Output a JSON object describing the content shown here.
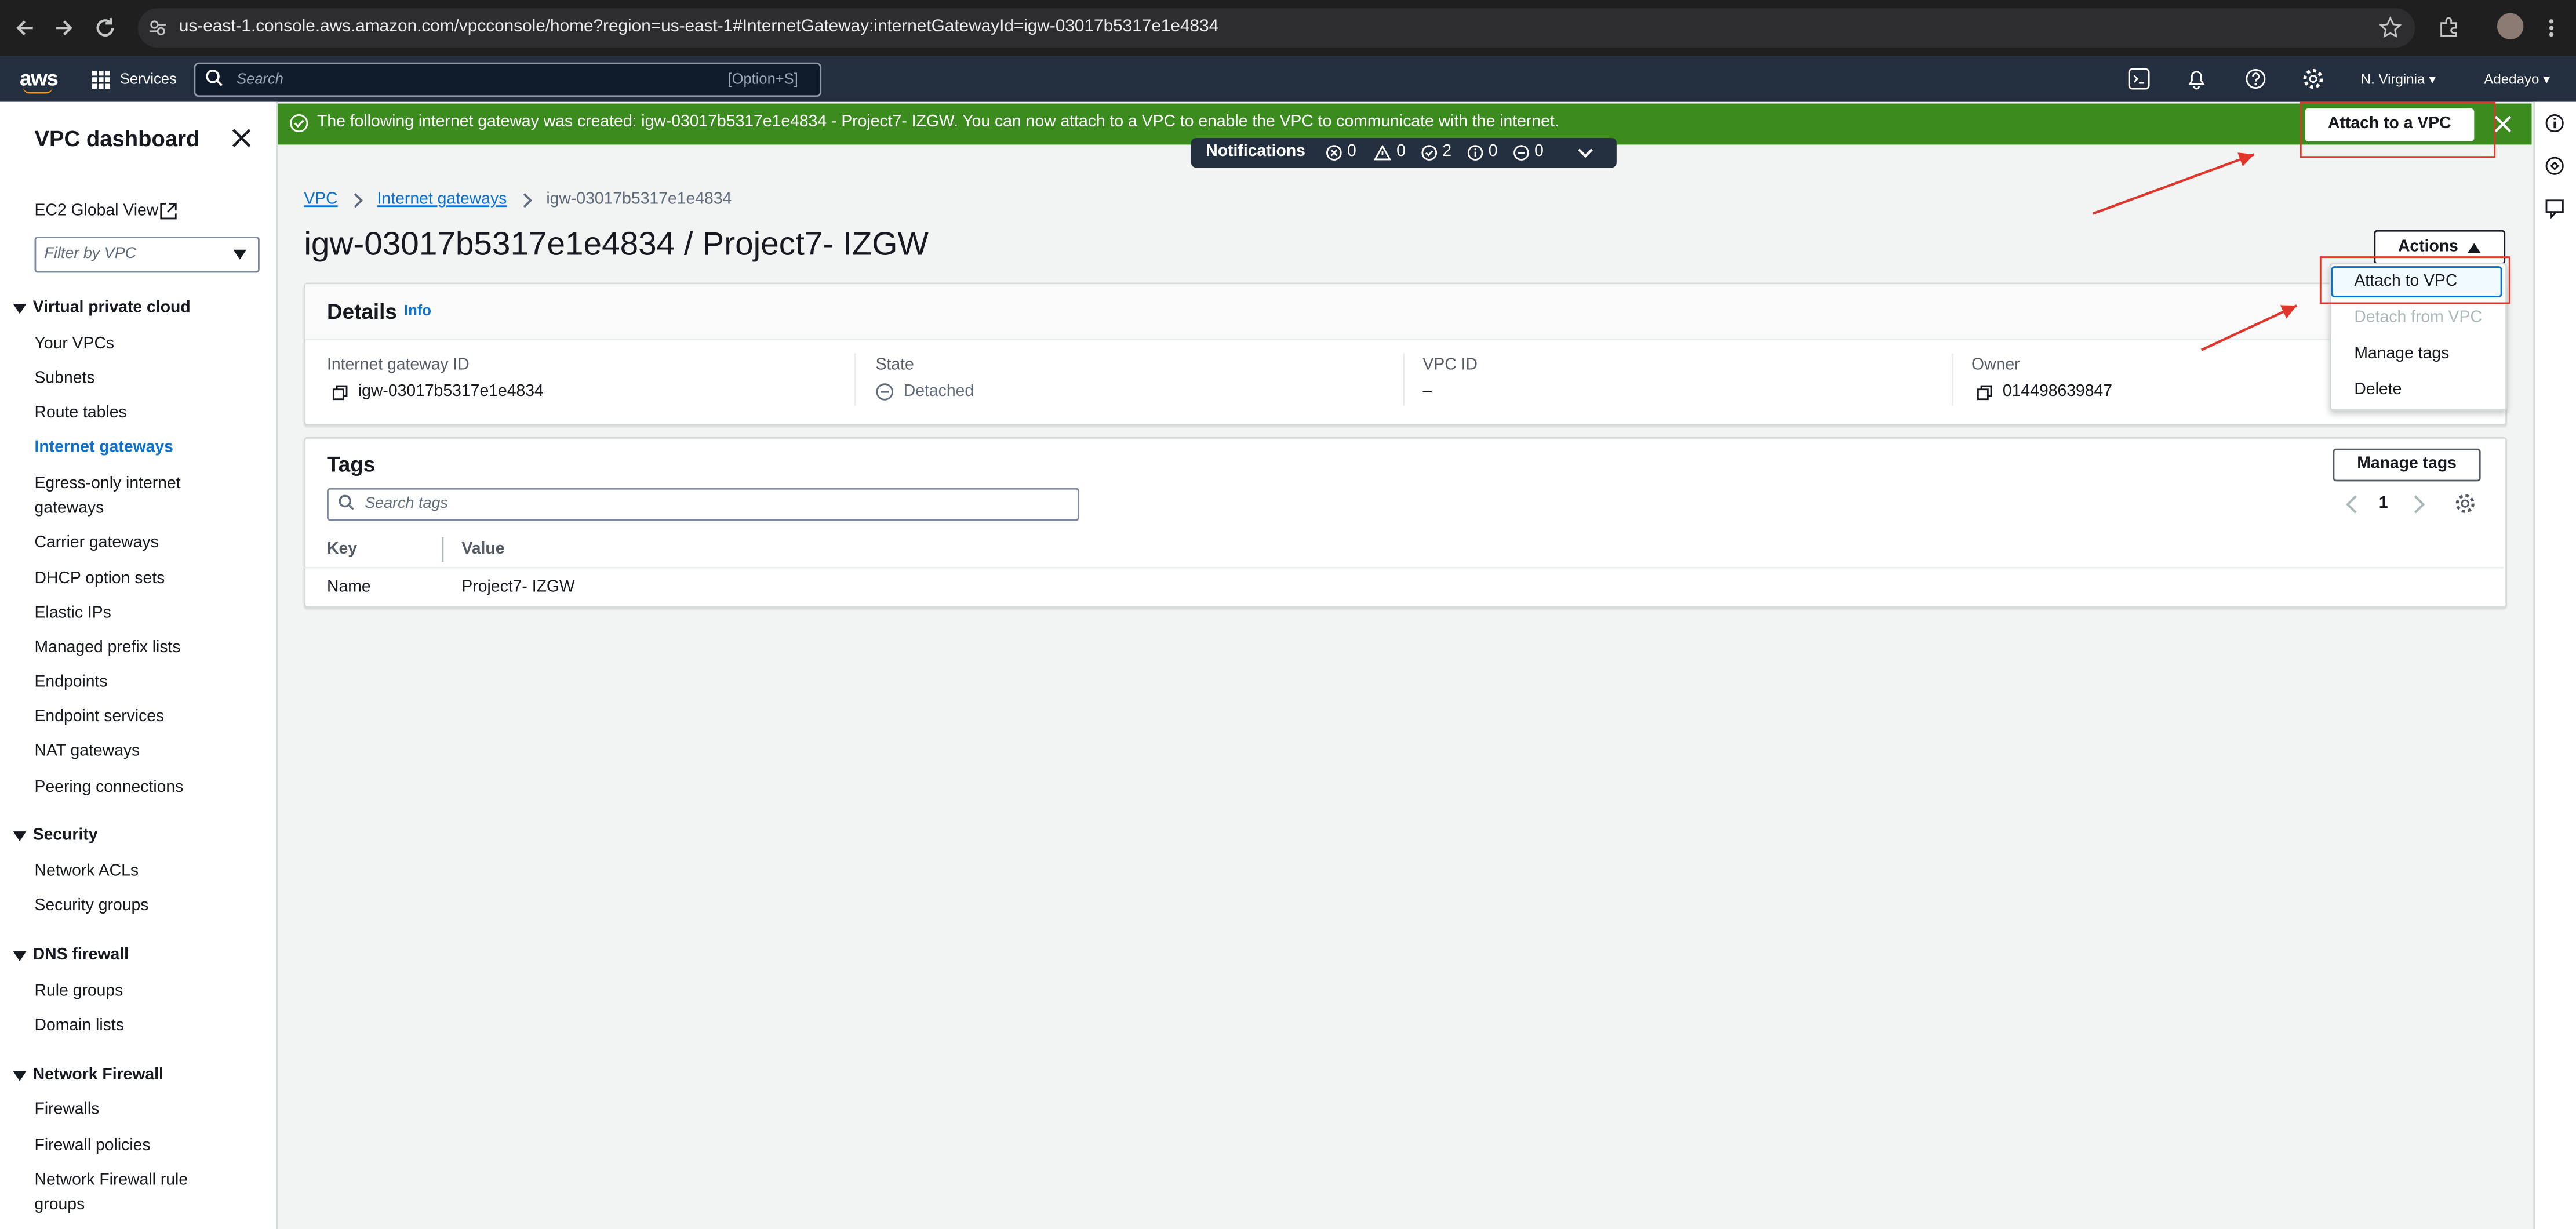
{
  "browser": {
    "url": "us-east-1.console.aws.amazon.com/vpcconsole/home?region=us-east-1#InternetGateway:internetGatewayId=igw-03017b5317e1e4834"
  },
  "aws_nav": {
    "logo": "aws",
    "services": "Services",
    "search_placeholder": "Search",
    "search_shortcut": "[Option+S]",
    "region": "N. Virginia ▾",
    "user": "Adedayo ▾"
  },
  "sidebar": {
    "title": "VPC dashboard",
    "ec2_global_view": "EC2 Global View",
    "filter_placeholder": "Filter by VPC",
    "sections": {
      "vpc": "Virtual private cloud",
      "security": "Security",
      "dns_firewall": "DNS firewall",
      "network_firewall": "Network Firewall"
    },
    "vpc_items": [
      "Your VPCs",
      "Subnets",
      "Route tables",
      "Internet gateways",
      "Egress-only internet",
      "gateways",
      "Carrier gateways",
      "DHCP option sets",
      "Elastic IPs",
      "Managed prefix lists",
      "Endpoints",
      "Endpoint services",
      "NAT gateways",
      "Peering connections"
    ],
    "security_items": [
      "Network ACLs",
      "Security groups"
    ],
    "dns_items": [
      "Rule groups",
      "Domain lists"
    ],
    "nf_items": [
      "Firewalls",
      "Firewall policies",
      "Network Firewall rule",
      "groups"
    ]
  },
  "flash": {
    "message": "The following internet gateway was created: igw-03017b5317e1e4834 - Project7- IZGW. You can now attach to a VPC to enable the VPC to communicate with the internet.",
    "attach_button": "Attach to a VPC",
    "color": "#3b8b1f"
  },
  "notifications": {
    "label": "Notifications",
    "error": "0",
    "warning": "0",
    "success": "2",
    "info": "0",
    "progress": "0"
  },
  "breadcrumb": {
    "root": "VPC",
    "parent": "Internet gateways",
    "current": "igw-03017b5317e1e4834"
  },
  "page": {
    "title": "igw-03017b5317e1e4834 / Project7- IZGW",
    "actions": "Actions"
  },
  "details": {
    "title": "Details",
    "info": "Info",
    "fields": {
      "igw_label": "Internet gateway ID",
      "igw_value": "igw-03017b5317e1e4834",
      "state_label": "State",
      "state_value": "Detached",
      "vpc_label": "VPC ID",
      "vpc_value": "–",
      "owner_label": "Owner",
      "owner_value": "014498639847"
    }
  },
  "tags": {
    "title": "Tags",
    "manage_button": "Manage tags",
    "search_placeholder": "Search tags",
    "page": "1",
    "columns": [
      "Key",
      "Value"
    ],
    "rows": [
      [
        "Name",
        "Project7- IZGW"
      ]
    ]
  },
  "actions_menu": {
    "items": [
      "Attach to VPC",
      "Detach from VPC",
      "Manage tags",
      "Delete"
    ]
  },
  "colors": {
    "link": "#0972d3",
    "annotation": "#e0352b",
    "nav_bg": "#232f3e"
  }
}
